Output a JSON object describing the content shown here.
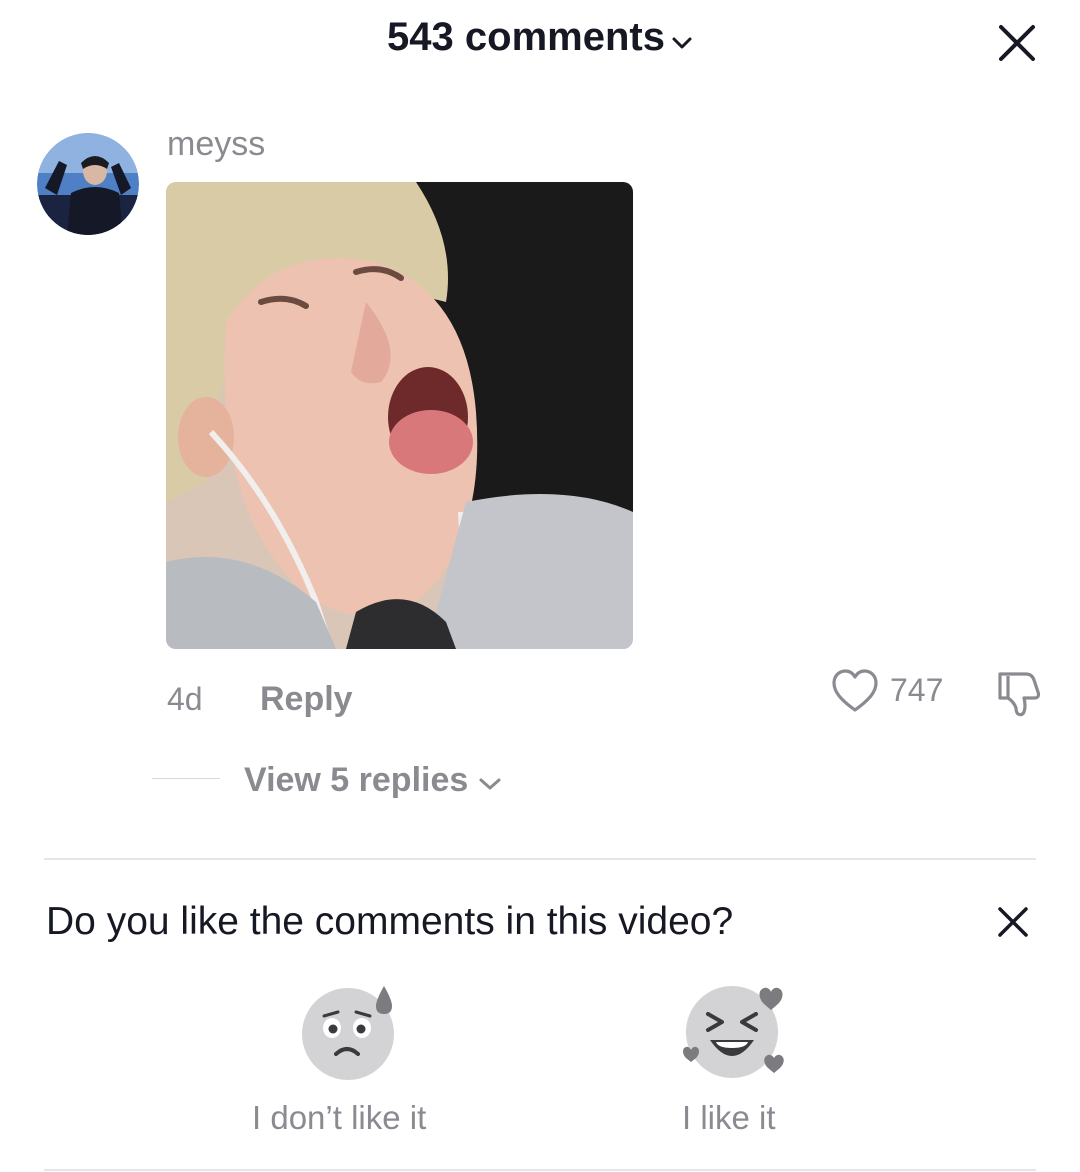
{
  "header": {
    "title": "543 comments"
  },
  "comment": {
    "username": "meyss",
    "time": "4d",
    "reply_label": "Reply",
    "like_count": "747",
    "view_replies_label": "View 5 replies"
  },
  "survey": {
    "question": "Do you like the comments in this video?",
    "dislike_label": "I don’t like it",
    "like_label": "I like it"
  },
  "colors": {
    "primary_text": "#161823",
    "secondary_text": "#8a8b91",
    "divider": "#e6e6e8"
  },
  "icons": [
    "chevron-down-icon",
    "close-icon",
    "heart-icon",
    "thumbs-down-icon",
    "sad-sweat-face-icon",
    "laughing-hearts-face-icon"
  ]
}
